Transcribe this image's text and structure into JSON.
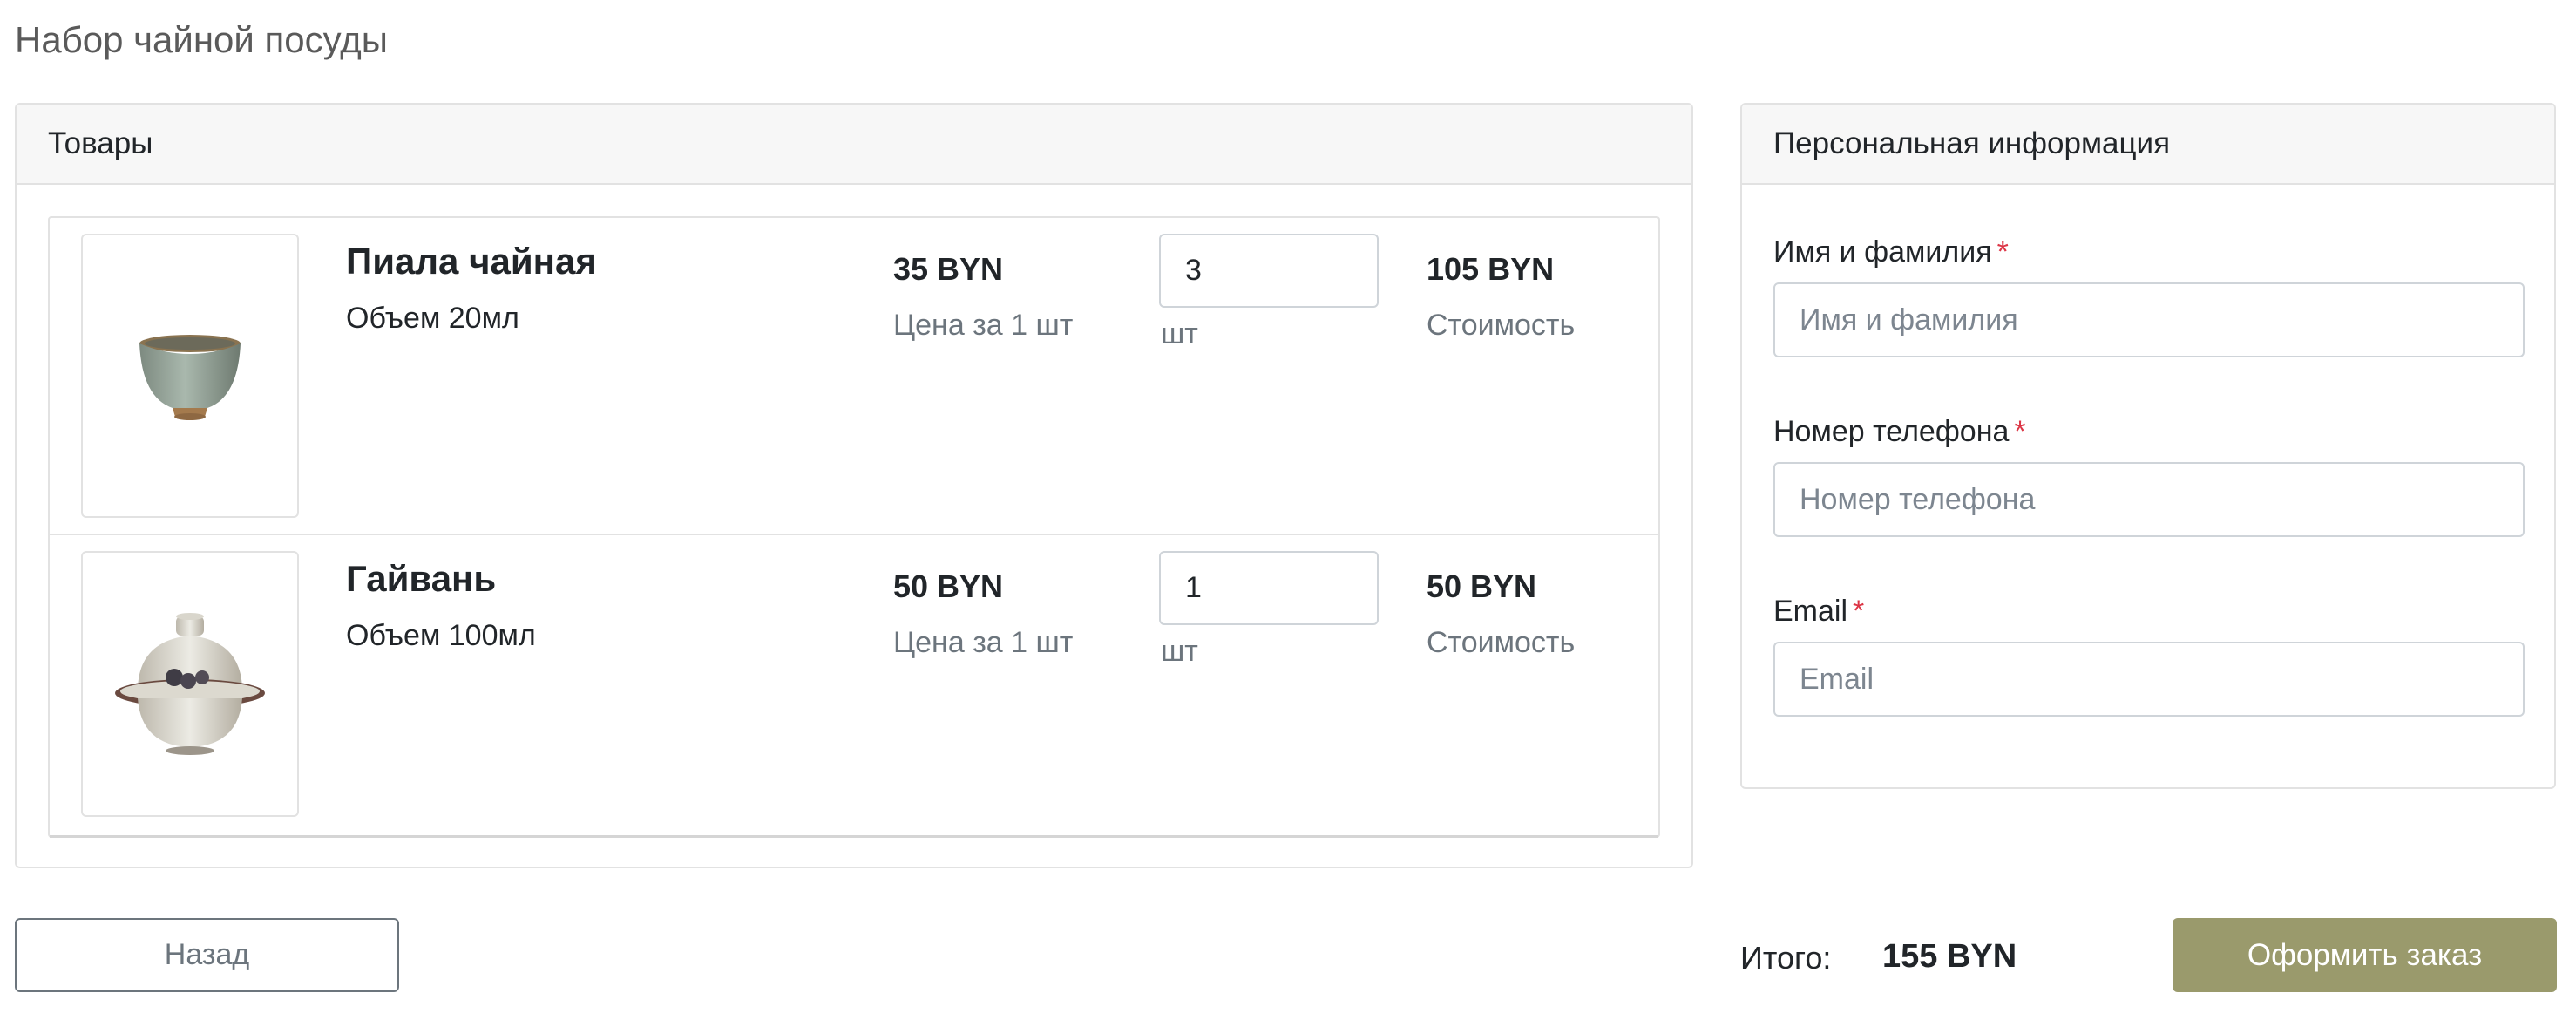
{
  "page": {
    "title": "Набор чайной посуды"
  },
  "products": {
    "header": "Товары",
    "items": [
      {
        "name": "Пиала чайная",
        "volume": "Объем 20мл",
        "price": "35 BYN",
        "price_label": "Цена за 1 шт",
        "quantity": "3",
        "unit": "шт",
        "cost": "105 BYN",
        "cost_label": "Стоимость",
        "image_icon": "tea-bowl-icon"
      },
      {
        "name": "Гайвань",
        "volume": "Объем 100мл",
        "price": "50 BYN",
        "price_label": "Цена за 1 шт",
        "quantity": "1",
        "unit": "шт",
        "cost": "50 BYN",
        "cost_label": "Стоимость",
        "image_icon": "gaiwan-icon"
      }
    ]
  },
  "personal": {
    "header": "Персональная информация",
    "required_mark": "*",
    "fields": {
      "name": {
        "label": "Имя и фамилия",
        "placeholder": "Имя и фамилия",
        "value": ""
      },
      "phone": {
        "label": "Номер телефона",
        "placeholder": "Номер телефона",
        "value": ""
      },
      "email": {
        "label": "Email",
        "placeholder": "Email",
        "value": ""
      }
    }
  },
  "footer": {
    "back_label": "Назад",
    "total_label": "Итого:",
    "total_value": "155 BYN",
    "order_label": "Оформить заказ"
  },
  "colors": {
    "accent": "#9a9a6c",
    "required": "#dc3545",
    "muted": "#6c757d",
    "header_bg": "#f7f7f7",
    "border": "#e2e2e2"
  }
}
